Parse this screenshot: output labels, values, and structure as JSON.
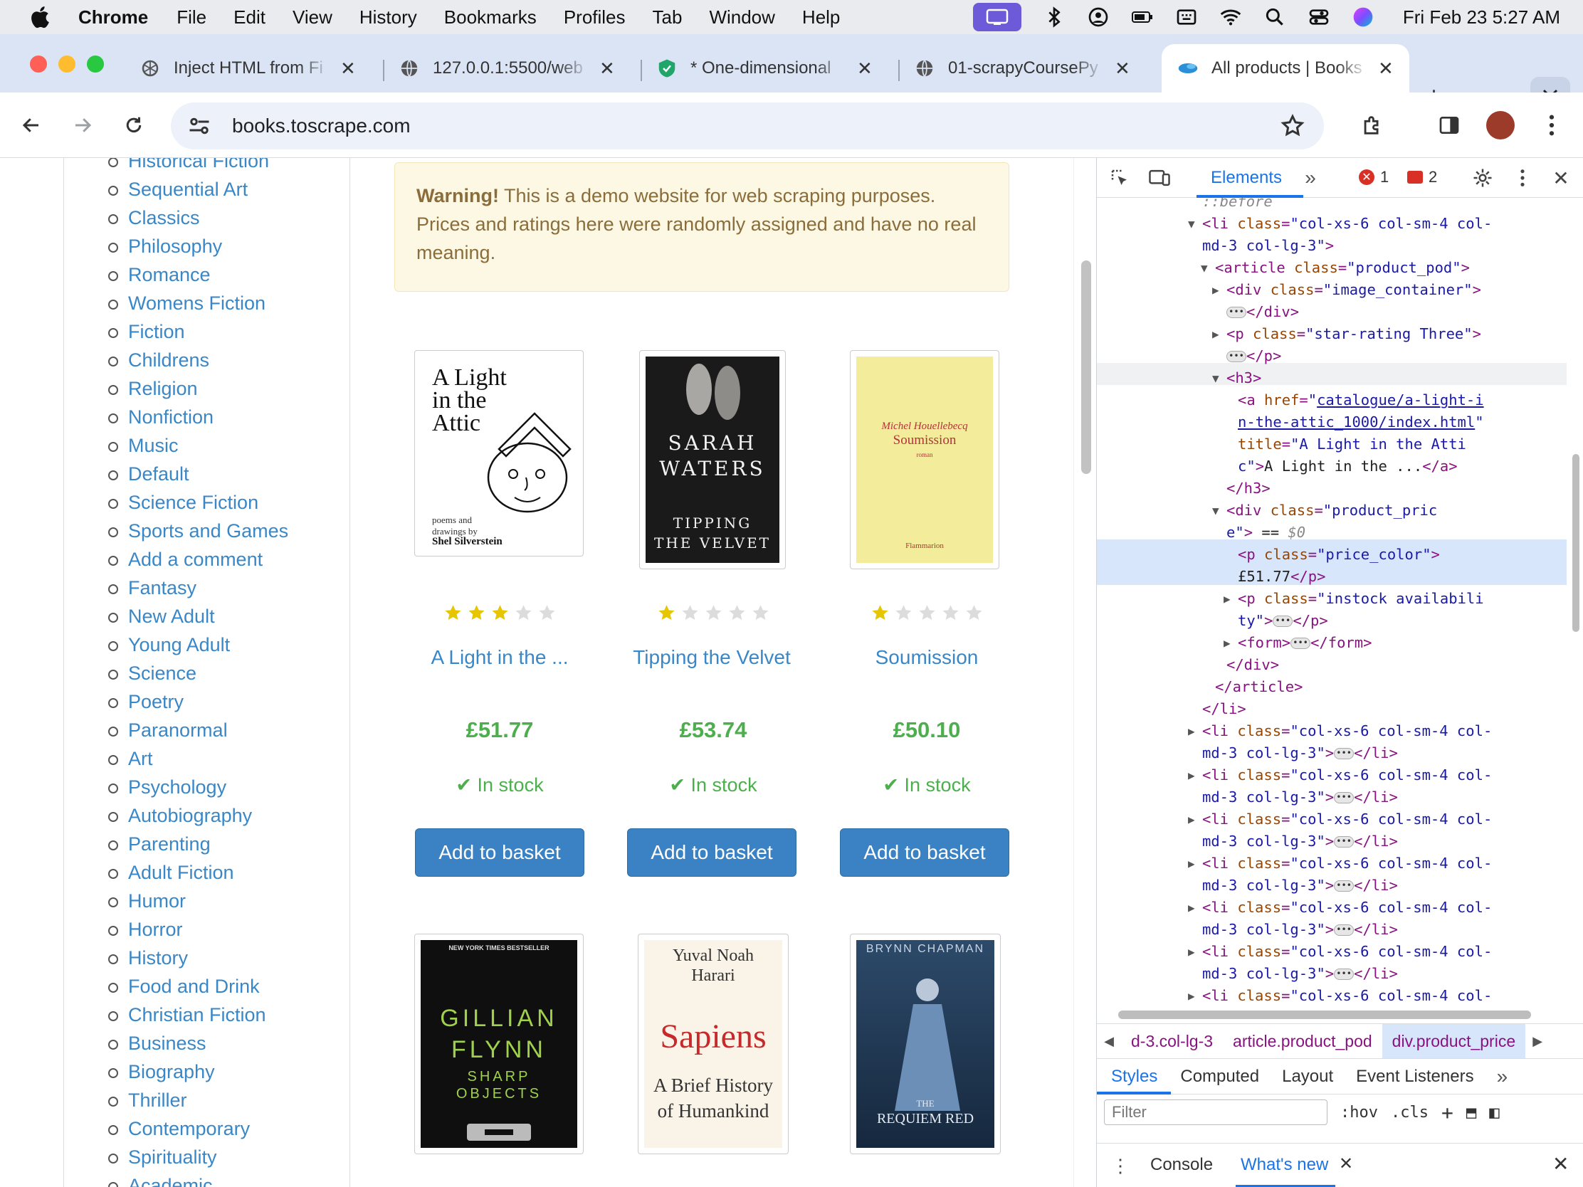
{
  "menubar": {
    "app": "Chrome",
    "items": [
      "File",
      "Edit",
      "View",
      "History",
      "Bookmarks",
      "Profiles",
      "Tab",
      "Window",
      "Help"
    ],
    "clock": "Fri Feb 23  5:27 AM"
  },
  "tabs": [
    {
      "title": "Inject HTML from Fi",
      "icon": "openai-icon"
    },
    {
      "title": "127.0.0.1:5500/web",
      "icon": "globe-icon"
    },
    {
      "title": "* One-dimensional",
      "icon": "shield-icon"
    },
    {
      "title": "01-scrapyCoursePy",
      "icon": "globe-icon"
    },
    {
      "title": "All products | Books",
      "icon": "blue-blob-icon",
      "active": true
    }
  ],
  "toolbar": {
    "url": "books.toscrape.com"
  },
  "sidebar": {
    "categories": [
      "Historical Fiction",
      "Sequential Art",
      "Classics",
      "Philosophy",
      "Romance",
      "Womens Fiction",
      "Fiction",
      "Childrens",
      "Religion",
      "Nonfiction",
      "Music",
      "Default",
      "Science Fiction",
      "Sports and Games",
      "Add a comment",
      "Fantasy",
      "New Adult",
      "Young Adult",
      "Science",
      "Poetry",
      "Paranormal",
      "Art",
      "Psychology",
      "Autobiography",
      "Parenting",
      "Adult Fiction",
      "Humor",
      "Horror",
      "History",
      "Food and Drink",
      "Christian Fiction",
      "Business",
      "Biography",
      "Thriller",
      "Contemporary",
      "Spirituality",
      "Academic"
    ]
  },
  "alert": {
    "strong": "Warning!",
    "text": " This is a demo website for web scraping purposes. Prices and ratings here were randomly assigned and have no real meaning."
  },
  "products": [
    {
      "title": "A Light in the ...",
      "rating": 3,
      "price": "£51.77",
      "stock": "In stock",
      "button": "Add to basket",
      "cover": {
        "lines": [
          "A Light",
          "in the",
          "Attic"
        ],
        "sub": "poems and drawings by",
        "author": "Shel Silverstein"
      }
    },
    {
      "title": "Tipping the Velvet",
      "rating": 1,
      "price": "£53.74",
      "stock": "In stock",
      "button": "Add to basket",
      "cover": {
        "lines": [
          "SARAH",
          "WATERS"
        ],
        "sub": "TIPPING",
        "author": "THE VELVET"
      }
    },
    {
      "title": "Soumission",
      "rating": 1,
      "price": "£50.10",
      "stock": "In stock",
      "button": "Add to basket",
      "cover": {
        "lines": [
          "Michel Houellebecq",
          "Soumission"
        ],
        "sub": "roman",
        "author": "Flammarion"
      }
    }
  ],
  "products_row2": [
    {
      "cover": {
        "lines": [
          "GILLIAN",
          "FLYNN"
        ],
        "sub": "SHARP",
        "author": "OBJECTS",
        "top": "NEW YORK TIMES BESTSELLER"
      }
    },
    {
      "cover": {
        "lines": [
          "Yuval Noah",
          "Harari"
        ],
        "sub": "Sapiens",
        "author": "A Brief History of Humankind"
      }
    },
    {
      "cover": {
        "lines": [
          "BRYNN CHAPMAN"
        ],
        "sub": "THE",
        "author": "REQUIEM RED"
      }
    }
  ],
  "devtools": {
    "panel": "Elements",
    "errors": "1",
    "warnings": "2",
    "dom": [
      {
        "indent": 0,
        "parts": [
          [
            "dim",
            "::before"
          ]
        ]
      },
      {
        "indent": 0,
        "tri": "▼",
        "parts": [
          [
            "tag",
            "<li "
          ],
          [
            "an",
            "class"
          ],
          [
            "tag",
            "="
          ],
          [
            "av",
            "\"col-xs-6 col-sm-4 col-"
          ]
        ]
      },
      {
        "indent": 0,
        "parts": [
          [
            "av",
            "md-3 col-lg-3\""
          ],
          [
            "tag",
            ">"
          ]
        ]
      },
      {
        "indent": 1,
        "tri": "▼",
        "parts": [
          [
            "tag",
            "<article "
          ],
          [
            "an",
            "class"
          ],
          [
            "tag",
            "="
          ],
          [
            "av",
            "\"product_pod\""
          ],
          [
            "tag",
            ">"
          ]
        ]
      },
      {
        "indent": 2,
        "tri": "▶",
        "parts": [
          [
            "tag",
            "<div "
          ],
          [
            "an",
            "class"
          ],
          [
            "tag",
            "="
          ],
          [
            "av",
            "\"image_container\""
          ],
          [
            "tag",
            ">"
          ]
        ]
      },
      {
        "indent": 2,
        "ell": true,
        "parts": [
          [
            "tag",
            "</div>"
          ]
        ]
      },
      {
        "indent": 2,
        "tri": "▶",
        "parts": [
          [
            "tag",
            "<p "
          ],
          [
            "an",
            "class"
          ],
          [
            "tag",
            "="
          ],
          [
            "av",
            "\"star-rating Three\""
          ],
          [
            "tag",
            ">"
          ]
        ]
      },
      {
        "indent": 2,
        "ell": true,
        "parts": [
          [
            "tag",
            "</p>"
          ]
        ]
      },
      {
        "indent": 2,
        "tri": "▼",
        "parts": [
          [
            "tag",
            "<h3>"
          ]
        ]
      },
      {
        "indent": 3,
        "parts": [
          [
            "tag",
            "<a "
          ],
          [
            "an",
            "href"
          ],
          [
            "tag",
            "="
          ],
          [
            "av",
            "\""
          ],
          [
            "ln",
            "catalogue/a-light-i"
          ]
        ]
      },
      {
        "indent": 3,
        "parts": [
          [
            "ln",
            "n-the-attic_1000/index.html"
          ],
          [
            "av",
            "\""
          ]
        ]
      },
      {
        "indent": 3,
        "parts": [
          [
            "an",
            "title"
          ],
          [
            "tag",
            "="
          ],
          [
            "av",
            "\"A Light in the Atti"
          ]
        ]
      },
      {
        "indent": 3,
        "parts": [
          [
            "av",
            "c\""
          ],
          [
            "tag",
            ">"
          ],
          [
            "tx",
            "A Light in the ..."
          ],
          [
            "tag",
            "</a>"
          ]
        ]
      },
      {
        "indent": 2,
        "parts": [
          [
            "tag",
            "</h3>"
          ]
        ]
      },
      {
        "indent": 2,
        "tri": "▼",
        "parts": [
          [
            "tag",
            "<div "
          ],
          [
            "an",
            "class"
          ],
          [
            "tag",
            "="
          ],
          [
            "av",
            "\"product_pric"
          ]
        ]
      },
      {
        "indent": 2,
        "parts": [
          [
            "av",
            "e\""
          ],
          [
            "tag",
            ">"
          ],
          [
            "tx",
            " == "
          ],
          [
            "dim",
            "$0"
          ]
        ]
      },
      {
        "indent": 3,
        "parts": [
          [
            "tag",
            "<p "
          ],
          [
            "an",
            "class"
          ],
          [
            "tag",
            "="
          ],
          [
            "av",
            "\"price_color\""
          ],
          [
            "tag",
            ">"
          ]
        ]
      },
      {
        "indent": 3,
        "parts": [
          [
            "tx",
            "£51.77"
          ],
          [
            "tag",
            "</p>"
          ]
        ]
      },
      {
        "indent": 3,
        "tri": "▶",
        "parts": [
          [
            "tag",
            "<p "
          ],
          [
            "an",
            "class"
          ],
          [
            "tag",
            "="
          ],
          [
            "av",
            "\"instock availabili"
          ]
        ]
      },
      {
        "indent": 3,
        "ellmid": true,
        "parts": [
          [
            "av",
            "ty\""
          ],
          [
            "tag",
            ">"
          ],
          [
            "ELL",
            ""
          ],
          [
            "tag",
            "</p>"
          ]
        ]
      },
      {
        "indent": 3,
        "tri": "▶",
        "parts": [
          [
            "tag",
            "<form>"
          ],
          [
            "ELL",
            ""
          ],
          [
            "tag",
            "</form>"
          ]
        ]
      },
      {
        "indent": 2,
        "parts": [
          [
            "tag",
            "</div>"
          ]
        ]
      },
      {
        "indent": 1,
        "parts": [
          [
            "tag",
            "</article>"
          ]
        ]
      },
      {
        "indent": 0,
        "parts": [
          [
            "tag",
            "</li>"
          ]
        ]
      },
      {
        "indent": 0,
        "tri": "▶",
        "parts": [
          [
            "tag",
            "<li "
          ],
          [
            "an",
            "class"
          ],
          [
            "tag",
            "="
          ],
          [
            "av",
            "\"col-xs-6 col-sm-4 col-"
          ]
        ]
      },
      {
        "indent": 0,
        "parts": [
          [
            "av",
            "md-3 col-lg-3\""
          ],
          [
            "tag",
            ">"
          ],
          [
            "ELL",
            ""
          ],
          [
            "tag",
            "</li>"
          ]
        ]
      },
      {
        "indent": 0,
        "tri": "▶",
        "parts": [
          [
            "tag",
            "<li "
          ],
          [
            "an",
            "class"
          ],
          [
            "tag",
            "="
          ],
          [
            "av",
            "\"col-xs-6 col-sm-4 col-"
          ]
        ]
      },
      {
        "indent": 0,
        "parts": [
          [
            "av",
            "md-3 col-lg-3\""
          ],
          [
            "tag",
            ">"
          ],
          [
            "ELL",
            ""
          ],
          [
            "tag",
            "</li>"
          ]
        ]
      },
      {
        "indent": 0,
        "tri": "▶",
        "parts": [
          [
            "tag",
            "<li "
          ],
          [
            "an",
            "class"
          ],
          [
            "tag",
            "="
          ],
          [
            "av",
            "\"col-xs-6 col-sm-4 col-"
          ]
        ]
      },
      {
        "indent": 0,
        "parts": [
          [
            "av",
            "md-3 col-lg-3\""
          ],
          [
            "tag",
            ">"
          ],
          [
            "ELL",
            ""
          ],
          [
            "tag",
            "</li>"
          ]
        ]
      },
      {
        "indent": 0,
        "tri": "▶",
        "parts": [
          [
            "tag",
            "<li "
          ],
          [
            "an",
            "class"
          ],
          [
            "tag",
            "="
          ],
          [
            "av",
            "\"col-xs-6 col-sm-4 col-"
          ]
        ]
      },
      {
        "indent": 0,
        "parts": [
          [
            "av",
            "md-3 col-lg-3\""
          ],
          [
            "tag",
            ">"
          ],
          [
            "ELL",
            ""
          ],
          [
            "tag",
            "</li>"
          ]
        ]
      },
      {
        "indent": 0,
        "tri": "▶",
        "parts": [
          [
            "tag",
            "<li "
          ],
          [
            "an",
            "class"
          ],
          [
            "tag",
            "="
          ],
          [
            "av",
            "\"col-xs-6 col-sm-4 col-"
          ]
        ]
      },
      {
        "indent": 0,
        "parts": [
          [
            "av",
            "md-3 col-lg-3\""
          ],
          [
            "tag",
            ">"
          ],
          [
            "ELL",
            ""
          ],
          [
            "tag",
            "</li>"
          ]
        ]
      },
      {
        "indent": 0,
        "tri": "▶",
        "parts": [
          [
            "tag",
            "<li "
          ],
          [
            "an",
            "class"
          ],
          [
            "tag",
            "="
          ],
          [
            "av",
            "\"col-xs-6 col-sm-4 col-"
          ]
        ]
      },
      {
        "indent": 0,
        "parts": [
          [
            "av",
            "md-3 col-lg-3\""
          ],
          [
            "tag",
            ">"
          ],
          [
            "ELL",
            ""
          ],
          [
            "tag",
            "</li>"
          ]
        ]
      },
      {
        "indent": 0,
        "tri": "▶",
        "parts": [
          [
            "tag",
            "<li "
          ],
          [
            "an",
            "class"
          ],
          [
            "tag",
            "="
          ],
          [
            "av",
            "\"col-xs-6 col-sm-4 col-"
          ]
        ]
      }
    ],
    "breadcrumbs": [
      "d-3.col-lg-3",
      "article.product_pod",
      "div.product_price"
    ],
    "subtabs": [
      "Styles",
      "Computed",
      "Layout",
      "Event Listeners"
    ],
    "filter_placeholder": "Filter",
    "filter_options": [
      ":hov",
      ".cls"
    ],
    "drawer": {
      "console": "Console",
      "whats_new": "What's new"
    }
  }
}
